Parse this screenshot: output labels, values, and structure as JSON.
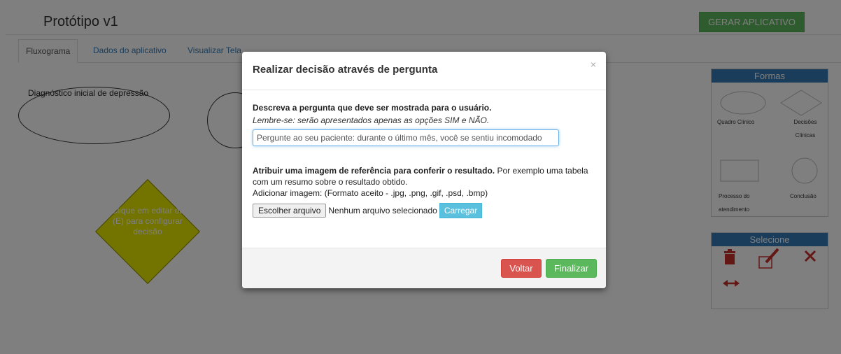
{
  "header": {
    "title": "Protótipo v1",
    "generate_button": "GERAR APLICATIVO"
  },
  "tabs": [
    {
      "label": "Fluxograma",
      "active": true
    },
    {
      "label": "Dados do aplicativo",
      "active": false
    },
    {
      "label": "Visualizar Tela",
      "active": false
    }
  ],
  "canvas": {
    "ellipse_label": "Diagnóstico inicial de depressão",
    "decision_label": "Clique em editar ou (E) para configurar decisão"
  },
  "forms_panel": {
    "title": "Formas",
    "items": [
      {
        "label": "Quadro Clínico",
        "icon": "ellipse-shape-icon"
      },
      {
        "label": "Decisões Clínicas",
        "icon": "diamond-shape-icon"
      },
      {
        "label": "Processo do atendimento",
        "icon": "rectangle-shape-icon"
      },
      {
        "label": "Conclusão",
        "icon": "circle-shape-icon"
      }
    ]
  },
  "select_panel": {
    "title": "Selecione",
    "tools": [
      "trash-icon",
      "edit-icon",
      "expand-icon",
      "resize-horizontal-icon"
    ]
  },
  "modal": {
    "title": "Realizar decisão através de pergunta",
    "close": "×",
    "question_label": "Descreva a pergunta que deve ser mostrada para o usuário.",
    "question_hint": "Lembre-se: serão apresentados apenas as opções SIM e NÃO.",
    "question_value": "Pergunte ao seu paciente: durante o último mês, você se sentiu incomodado",
    "image_label_bold": "Atribuir uma imagem de referência para conferir o resultado.",
    "image_label_rest": " Por exemplo uma tabela com um resumo sobre o resultado obtido.",
    "add_image_label": "Adicionar imagem: (Formato aceito - .jpg, .png, .gif, .psd, .bmp)",
    "file_button": "Escolher arquivo",
    "file_status": "Nenhum arquivo selecionado",
    "upload_button": "Carregar",
    "back_button": "Voltar",
    "finish_button": "Finalizar"
  },
  "colors": {
    "primary": "#337ab7",
    "success": "#5cb85c",
    "danger": "#d9534f",
    "info": "#5bc0de",
    "diamond": "#e6e600"
  }
}
